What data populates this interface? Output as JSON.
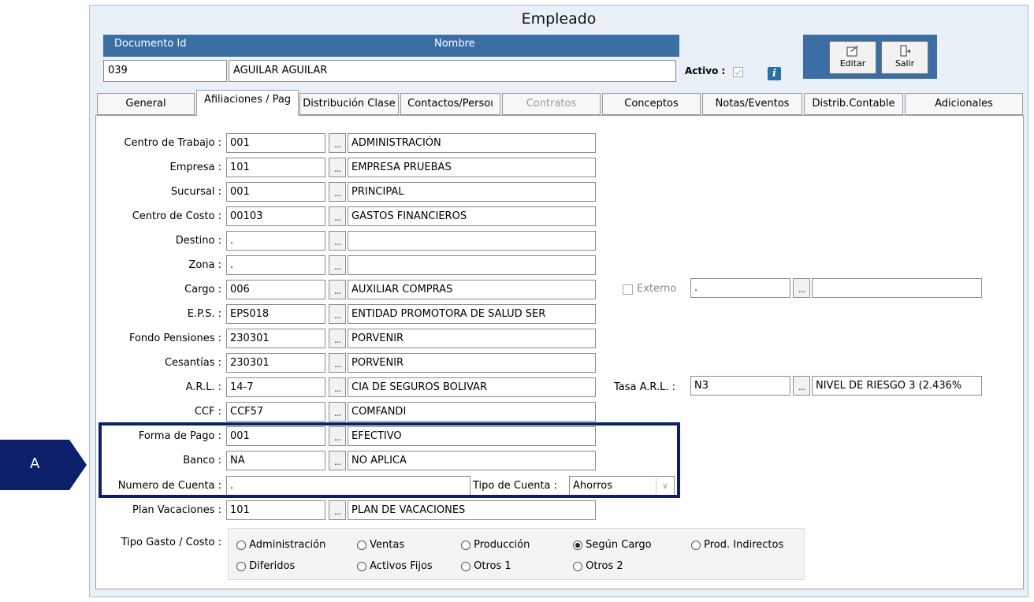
{
  "window": {
    "title": "Empleado"
  },
  "header": {
    "doc_label": "Documento Id",
    "name_label": "Nombre",
    "doc_value": "039",
    "name_value": "AGUILAR  AGUILAR",
    "activo_label": "Activo :",
    "info_icon": "i"
  },
  "toolbar": {
    "edit_label": "Editar",
    "exit_label": "Salir"
  },
  "tabs": [
    {
      "label": "General"
    },
    {
      "label": "Afiliaciones / Pag"
    },
    {
      "label": "Distribución Clase"
    },
    {
      "label": "Contactos/Persoı"
    },
    {
      "label": "Contratos"
    },
    {
      "label": "Conceptos"
    },
    {
      "label": "Notas/Eventos"
    },
    {
      "label": "Distrib.Contable"
    },
    {
      "label": "Adicionales"
    }
  ],
  "dots": "...",
  "rows": [
    {
      "label": "Centro de Trabajo :",
      "code": "001",
      "desc": "ADMINISTRACIÓN"
    },
    {
      "label": "Empresa :",
      "code": "101",
      "desc": "EMPRESA PRUEBAS"
    },
    {
      "label": "Sucursal :",
      "code": "001",
      "desc": "PRINCIPAL"
    },
    {
      "label": "Centro de Costo :",
      "code": "00103",
      "desc": "GASTOS FINANCIEROS"
    },
    {
      "label": "Destino :",
      "code": ".",
      "desc": ""
    },
    {
      "label": "Zona :",
      "code": ".",
      "desc": ""
    },
    {
      "label": "Cargo :",
      "code": "006",
      "desc": "AUXILIAR COMPRAS"
    },
    {
      "label": "E.P.S. :",
      "code": "EPS018",
      "desc": "ENTIDAD PROMOTORA DE SALUD SER"
    },
    {
      "label": "Fondo Pensiones :",
      "code": "230301",
      "desc": "PORVENIR"
    },
    {
      "label": "Cesantías :",
      "code": "230301",
      "desc": "PORVENIR"
    },
    {
      "label": "A.R.L. :",
      "code": "14-7",
      "desc": "CIA DE SEGUROS BOLIVAR"
    },
    {
      "label": "CCF :",
      "code": "CCF57",
      "desc": "COMFANDI"
    },
    {
      "label": "Forma de Pago :",
      "code": "001",
      "desc": "EFECTIVO"
    },
    {
      "label": "Banco :",
      "code": "NA",
      "desc": "NO APLICA"
    }
  ],
  "cuenta": {
    "label": "Numero de Cuenta :",
    "value": ".",
    "tipo_label": "Tipo de Cuenta :",
    "tipo_value": "Ahorros"
  },
  "plan": {
    "label": "Plan Vacaciones :",
    "code": "101",
    "desc": "PLAN DE VACACIONES"
  },
  "externo": {
    "label": "Externo",
    "code": ".",
    "desc": ""
  },
  "tasa": {
    "label": "Tasa A.R.L. :",
    "code": "N3",
    "desc": "NIVEL DE RIESGO 3 (2.436%"
  },
  "gasto": {
    "label": "Tipo Gasto / Costo :",
    "options": [
      {
        "label": "Administración"
      },
      {
        "label": "Ventas"
      },
      {
        "label": "Producción"
      },
      {
        "label": "Según Cargo",
        "selected": true
      },
      {
        "label": "Prod. Indirectos"
      },
      {
        "label": "Diferidos"
      },
      {
        "label": "Activos Fijos"
      },
      {
        "label": "Otros 1"
      },
      {
        "label": "Otros 2"
      }
    ]
  },
  "annotation": {
    "label": "A"
  },
  "colors": {
    "header_blue": "#3a6ea5",
    "annotation_navy": "#0b1f6b"
  }
}
